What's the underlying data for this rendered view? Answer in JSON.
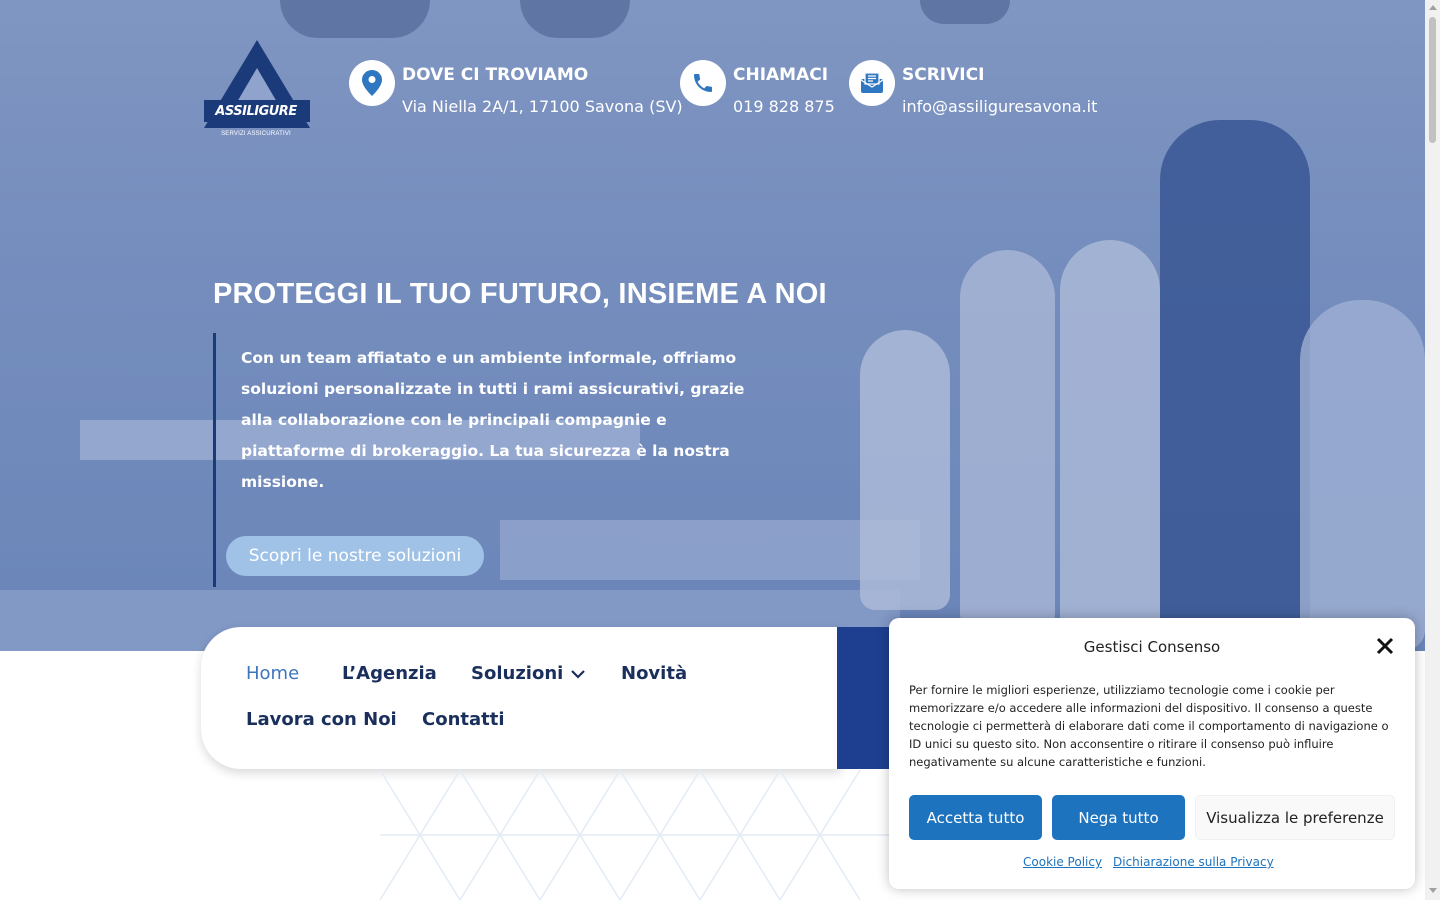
{
  "header": {
    "logo": {
      "wordmark": "ASSILIGURE",
      "tagline": "SERVIZI ASSICURATIVI"
    },
    "contacts": [
      {
        "icon": "map-pin-icon",
        "title": "DOVE CI TROVIAMO",
        "value": "Via Niella 2A/1, 17100 Savona (SV)"
      },
      {
        "icon": "phone-icon",
        "title": "CHIAMACI",
        "value": "019 828 875"
      },
      {
        "icon": "envelope-icon",
        "title": "SCRIVICI",
        "value": "info@assiliguresavona.it"
      }
    ]
  },
  "hero": {
    "headline": "PROTEGGI IL TUO FUTURO, INSIEME A NOI",
    "intro": "Con un team affiatato e un ambiente informale, offriamo soluzioni personalizzate in tutti i rami assicurativi, grazie alla collaborazione con le principali compagnie e piattaforme di brokeraggio. La tua sicurezza è la nostra missione.",
    "cta_label": "Scopri le nostre soluzioni"
  },
  "nav": {
    "items": [
      {
        "label": "Home",
        "active": true
      },
      {
        "label": "L’Agenzia"
      },
      {
        "label": "Soluzioni",
        "has_dropdown": true
      },
      {
        "label": "Novità"
      },
      {
        "label": "Lavora con Noi"
      },
      {
        "label": "Contatti"
      }
    ]
  },
  "consent": {
    "title": "Gestisci Consenso",
    "body": "Per fornire le migliori esperienze, utilizziamo tecnologie come i cookie per memorizzare e/o accedere alle informazioni del dispositivo. Il consenso a queste tecnologie ci permetterà di elaborare dati come il comportamento di navigazione o ID unici su questo sito. Non acconsentire o ritirare il consenso può influire negativamente su alcune caratteristiche e funzioni.",
    "accept_label": "Accetta tutto",
    "deny_label": "Nega tutto",
    "prefs_label": "Visualizza le preferenze",
    "cookie_policy_label": "Cookie Policy",
    "privacy_label": "Dichiarazione sulla Privacy"
  },
  "colors": {
    "brand_navy": "#1b3a7a",
    "accent_blue": "#1e73be",
    "cta_light_blue": "#9fc2e6",
    "nav_text": "#1a2f5c",
    "nav_active": "#3e74bd"
  }
}
